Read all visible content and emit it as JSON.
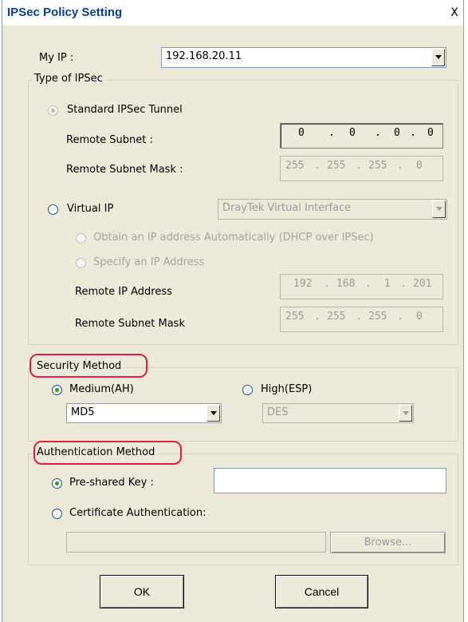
{
  "window": {
    "title": "IPSec Policy Setting",
    "close_glyph": "X"
  },
  "my_ip": {
    "label": "My IP :",
    "value": "192.168.20.11"
  },
  "type_group": {
    "legend": "Type of IPSec",
    "standard": {
      "label": "Standard IPSec Tunnel",
      "checked": true,
      "remote_subnet_label": "Remote Subnet :",
      "remote_subnet": [
        "0",
        ".",
        "0",
        ".",
        "0",
        ".",
        "0"
      ],
      "remote_mask_label": "Remote Subnet Mask :",
      "remote_mask": [
        "255",
        ".",
        "255",
        ".",
        "255",
        ".",
        "0"
      ]
    },
    "virtual": {
      "label": "Virtual IP",
      "checked": false,
      "interface": "DrayTek Virtual Interface",
      "dhcp_label": "Obtain an IP address Automatically (DHCP over IPSec)",
      "specify_label": "Specify an IP Address",
      "remote_ip_label": "Remote IP Address",
      "remote_ip": [
        "192",
        ".",
        "168",
        ".",
        "1",
        ".",
        "201"
      ],
      "remote_mask_label": "Remote Subnet Mask",
      "remote_mask": [
        "255",
        ".",
        "255",
        ".",
        "255",
        ".",
        "0"
      ]
    }
  },
  "security_group": {
    "legend": "Security Method",
    "medium_label": "Medium(AH)",
    "medium_checked": true,
    "medium_value": "MD5",
    "high_label": "High(ESP)",
    "high_checked": false,
    "high_value": "DES"
  },
  "auth_group": {
    "legend": "Authentication Method",
    "psk_label": "Pre-shared Key :",
    "psk_checked": true,
    "psk_value": "",
    "cert_label": "Certificate Authentication:",
    "cert_checked": false,
    "cert_value": "",
    "browse_label": "Browse..."
  },
  "buttons": {
    "ok": "OK",
    "cancel": "Cancel"
  },
  "colors": {
    "highlight": "#e0203a",
    "dialog_bg": "#ece9d8",
    "title": "#0b3d9a"
  }
}
